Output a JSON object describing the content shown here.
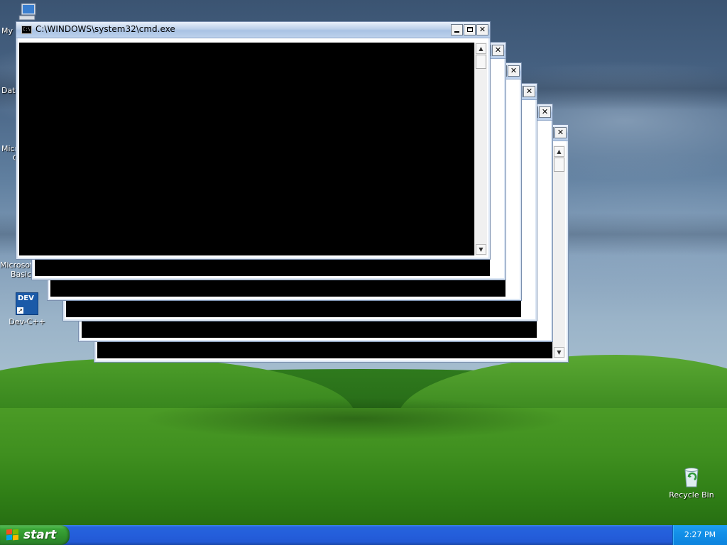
{
  "desktop": {
    "icons": [
      {
        "label": "My"
      },
      {
        "label": "Dat"
      },
      {
        "label_line1": "Micro",
        "label_line2": "C"
      },
      {
        "label_line1": "Microsof",
        "label_line2": "Basic"
      },
      {
        "label": "Dev-C++",
        "badge": "DEV"
      },
      {
        "label": "Recycle Bin"
      }
    ]
  },
  "windows": {
    "front_title": "C:\\WINDOWS\\system32\\cmd.exe",
    "icon_glyph": "C:\\",
    "btn_minimize": "minimize",
    "btn_maximize": "maximize",
    "btn_close": "✕",
    "scroll_up": "▲",
    "scroll_down": "▼"
  },
  "taskbar": {
    "start_label": "start",
    "clock": "2:27 PM"
  },
  "colors": {
    "console_bg": "#000000",
    "taskbar_blue": "#245edb",
    "start_green": "#3aa537",
    "tray_blue": "#1390e8"
  }
}
